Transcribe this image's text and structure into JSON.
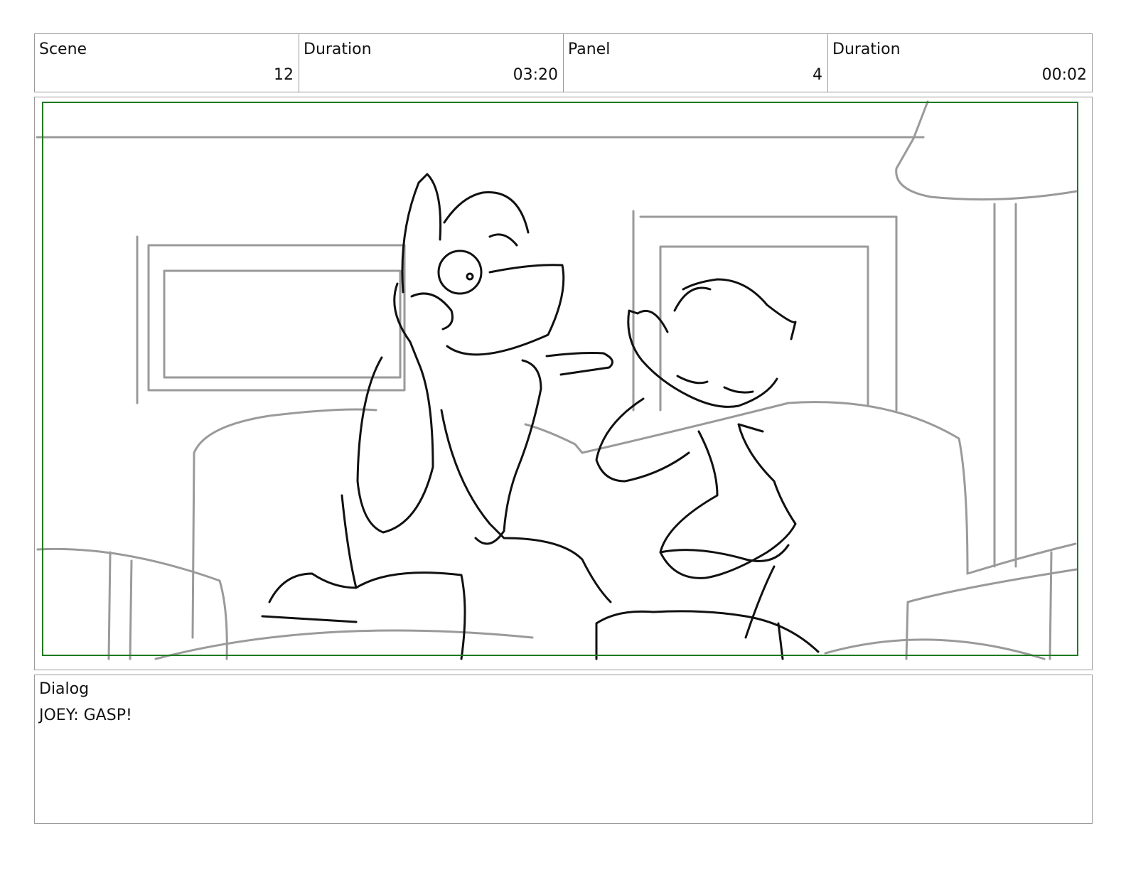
{
  "header": {
    "cells": [
      {
        "label": "Scene",
        "value": "12"
      },
      {
        "label": "Duration",
        "value": "03:20"
      },
      {
        "label": "Panel",
        "value": "4"
      },
      {
        "label": "Duration",
        "value": "00:02"
      }
    ]
  },
  "panel": {
    "safe_frame_color": "#1f7a1f",
    "background_line_color": "#9a9a9a",
    "character_line_color": "#111111"
  },
  "dialog": {
    "label": "Dialog",
    "text": "JOEY: GASP!"
  }
}
